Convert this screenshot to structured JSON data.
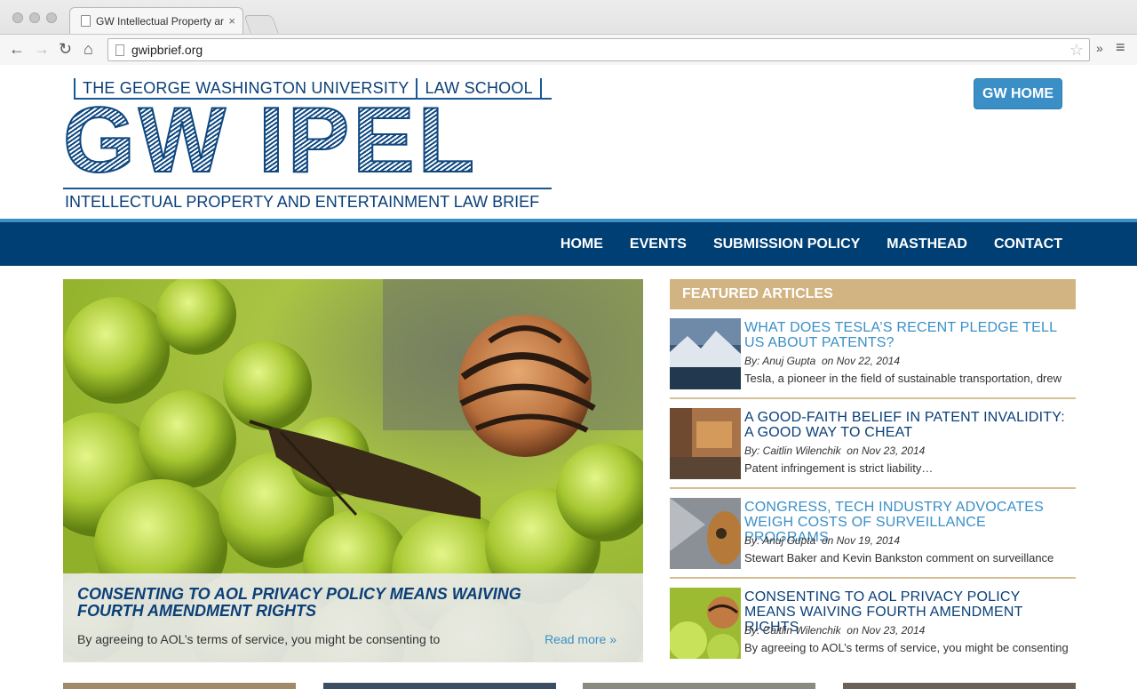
{
  "browser": {
    "tab_title": "GW Intellectual Property ar",
    "tab_close": "×",
    "url": "gwipbrief.org",
    "back": "←",
    "forward": "→",
    "reload": "↻",
    "home": "⌂",
    "star": "☆",
    "extensions": "»",
    "menu": "≡"
  },
  "logo": {
    "top_left": "THE GEORGE WASHINGTON UNIVERSITY",
    "top_right": "LAW SCHOOL",
    "big": "GW IPEL",
    "bottom": "INTELLECTUAL PROPERTY AND ENTERTAINMENT LAW BRIEF"
  },
  "header": {
    "gw_home": "GW HOME"
  },
  "nav": [
    "HOME",
    "EVENTS",
    "SUBMISSION POLICY",
    "MASTHEAD",
    "CONTACT"
  ],
  "feature": {
    "title": "CONSENTING TO AOL PRIVACY POLICY MEANS WAIVING FOURTH AMENDMENT RIGHTS",
    "excerpt": "By agreeing to AOL’s terms of service, you might be consenting to",
    "read_more": "Read more »"
  },
  "sidebar": {
    "header": "FEATURED ARTICLES",
    "articles": [
      {
        "title": "WHAT DOES TESLA’S RECENT PLEDGE TELL US ABOUT PATENTS?",
        "author": "By: Anuj Gupta",
        "date": "on Nov 22, 2014",
        "excerpt": "Tesla, a pioneer in the field of sustainable transportation, drew"
      },
      {
        "title": "A GOOD-FAITH BELIEF IN PATENT INVALIDITY: A GOOD WAY TO CHEAT",
        "author": "By: Caitlin Wilenchik",
        "date": "on Nov 23, 2014",
        "excerpt": "Patent infringement is strict liability…"
      },
      {
        "title": "CONGRESS, TECH INDUSTRY ADVOCATES WEIGH COSTS OF SURVEILLANCE PROGRAMS",
        "author": "By: Anuj Gupta",
        "date": "on Nov 19, 2014",
        "excerpt": "Stewart Baker and Kevin Bankston comment on surveillance"
      },
      {
        "title": "CONSENTING TO AOL PRIVACY POLICY MEANS WAIVING FOURTH AMENDMENT RIGHTS",
        "author": "By: Caitlin Wilenchik",
        "date": "on Nov 23, 2014",
        "excerpt": "By agreeing to AOL’s terms of service, you might be consenting"
      }
    ]
  },
  "colors": {
    "navy": "#003f74",
    "accent_blue": "#3a8fc6",
    "tan": "#d2b382"
  }
}
